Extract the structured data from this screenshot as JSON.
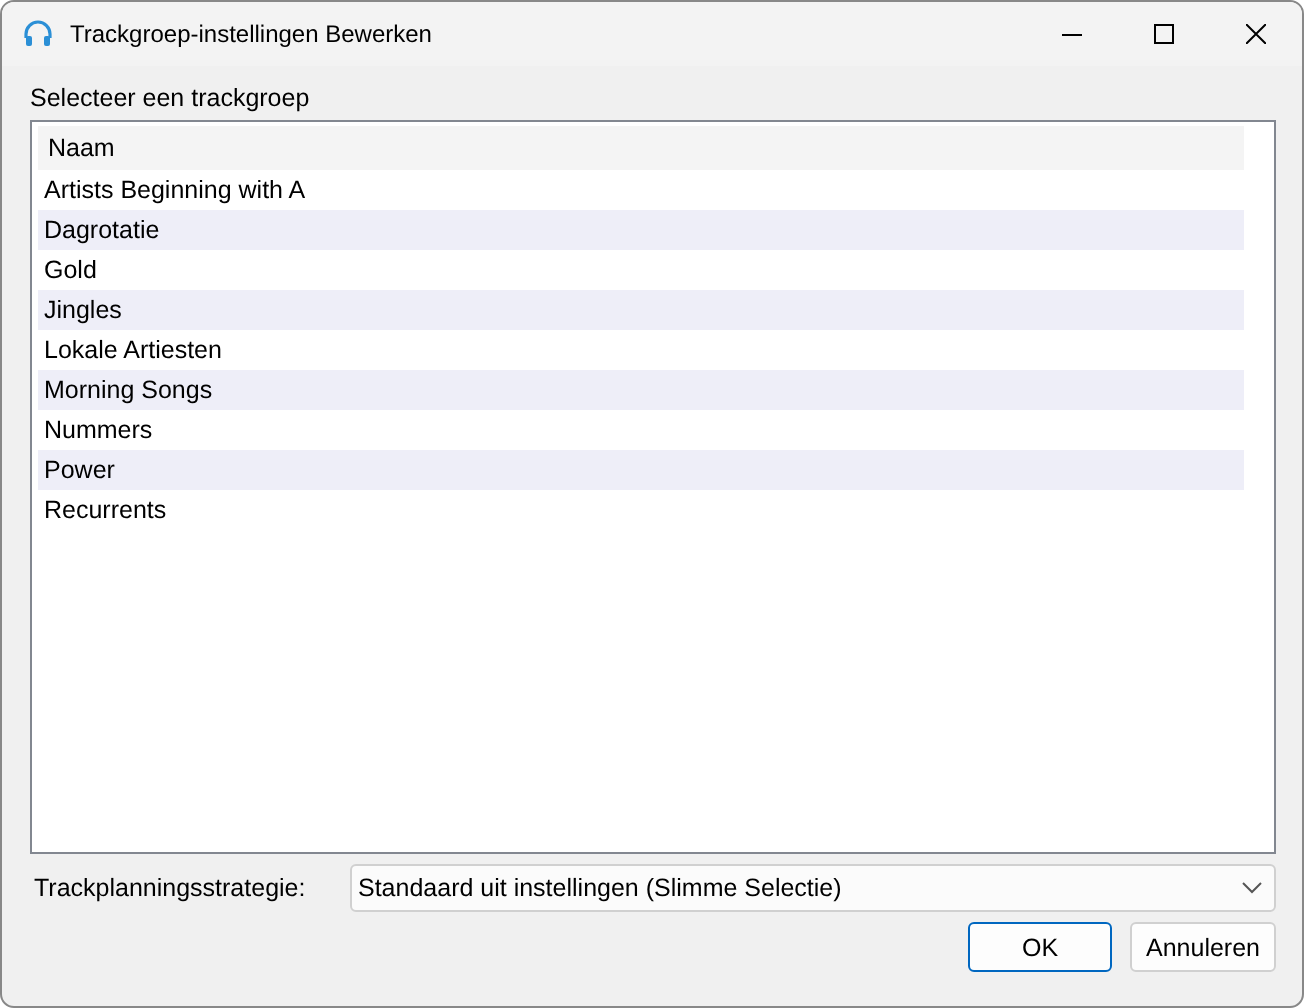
{
  "window": {
    "title": "Trackgroep-instellingen Bewerken"
  },
  "list_label": "Selecteer een trackgroep",
  "table": {
    "columns": [
      "Naam"
    ],
    "rows": [
      "Artists Beginning with A",
      "Dagrotatie",
      "Gold",
      "Jingles",
      "Lokale Artiesten",
      "Morning Songs",
      "Nummers",
      "Power",
      "Recurrents"
    ]
  },
  "strategy": {
    "label": "Trackplanningsstrategie:",
    "value": "Standaard uit instellingen (Slimme Selectie)"
  },
  "buttons": [
    {
      "label": "OK",
      "default": true
    },
    {
      "label": "Annuleren",
      "default": false
    }
  ]
}
